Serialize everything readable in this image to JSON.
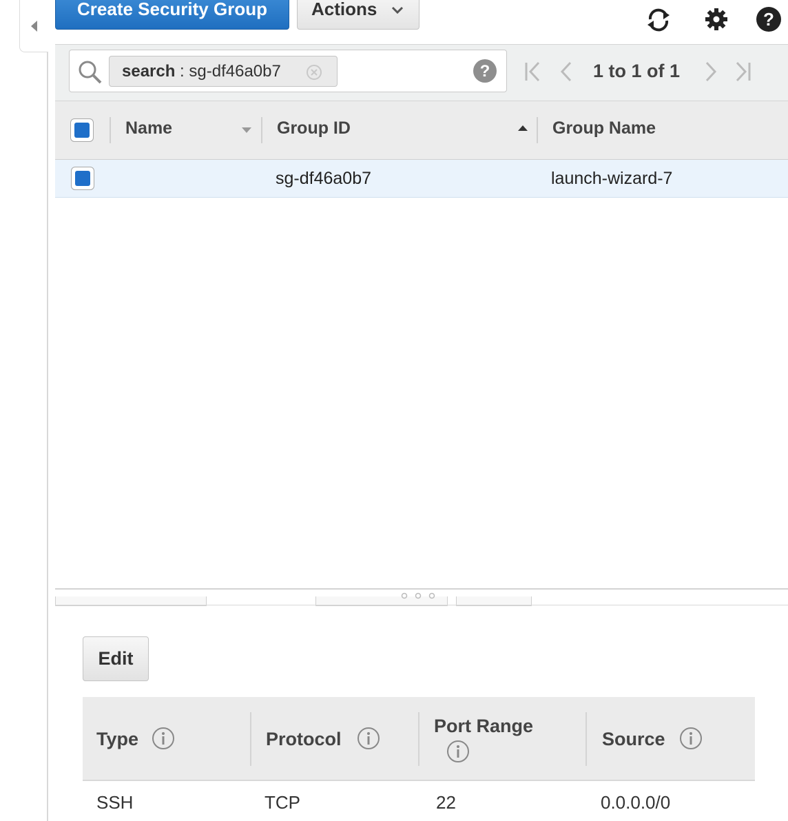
{
  "toolbar": {
    "create_label": "Create Security Group",
    "actions_label": "Actions"
  },
  "search": {
    "token_key": "search",
    "token_sep": " : ",
    "token_value": "sg-df46a0b7",
    "pager": "1 to 1 of 1"
  },
  "table": {
    "columns": [
      "Name",
      "Group ID",
      "Group Name"
    ],
    "rows": [
      {
        "name": "",
        "group_id": "sg-df46a0b7",
        "group_name": "launch-wizard-7",
        "selected": true
      }
    ]
  },
  "details": {
    "edit_label": "Edit",
    "columns": [
      "Type",
      "Protocol",
      "Port Range",
      "Source"
    ],
    "rows": [
      {
        "type": "SSH",
        "protocol": "TCP",
        "port_range": "22",
        "source": "0.0.0.0/0"
      }
    ]
  },
  "colors": {
    "primary": "#1f6fc0",
    "checkbox": "#1f6fc9",
    "selected_row": "#eaf3fc"
  },
  "icons": [
    "refresh-icon",
    "gear-icon",
    "help-icon",
    "search-icon",
    "clear-icon",
    "first-page-icon",
    "prev-page-icon",
    "next-page-icon",
    "last-page-icon",
    "info-icon"
  ]
}
